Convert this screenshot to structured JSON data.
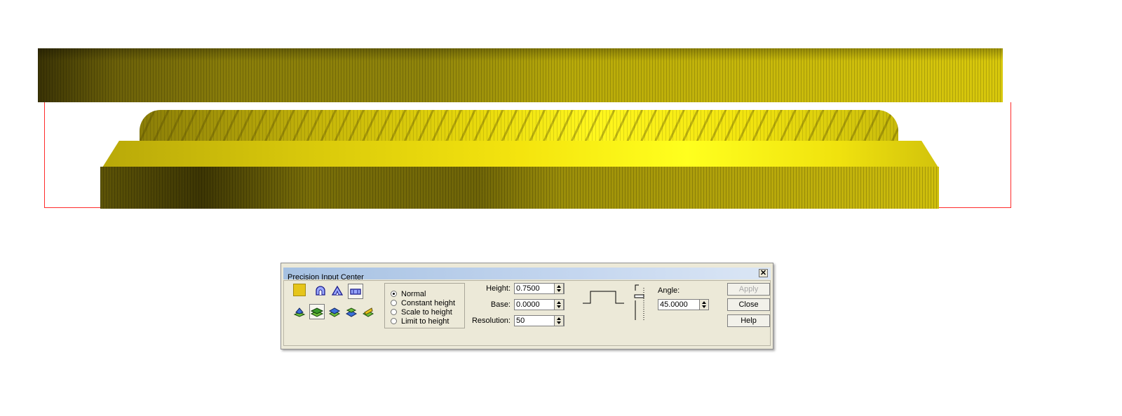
{
  "dialog": {
    "title": "Precision Input Center",
    "close_glyph": "✕",
    "color_swatch": "#e6c51a",
    "tools_row1": [
      "color-swatch",
      "dome-icon",
      "pyramid-icon",
      "flat-icon"
    ],
    "tools_row2": [
      "merge-highest-icon",
      "add-icon",
      "subtract-icon",
      "merge-lowest-icon",
      "replace-icon"
    ],
    "mode": {
      "options": [
        "Normal",
        "Constant height",
        "Scale to height",
        "Limit to height"
      ],
      "selected": "Normal"
    },
    "height": {
      "label": "Height:",
      "value": "0.7500"
    },
    "base": {
      "label": "Base:",
      "value": "0.0000"
    },
    "resolution": {
      "label": "Resolution:",
      "value": "50"
    },
    "angle": {
      "label": "Angle:",
      "value": "45.0000"
    },
    "buttons": {
      "apply": "Apply",
      "close": "Close",
      "help": "Help"
    }
  },
  "colors": {
    "relief_yellow": "#ffff1e",
    "bounding_box": "#ff2b2b"
  }
}
